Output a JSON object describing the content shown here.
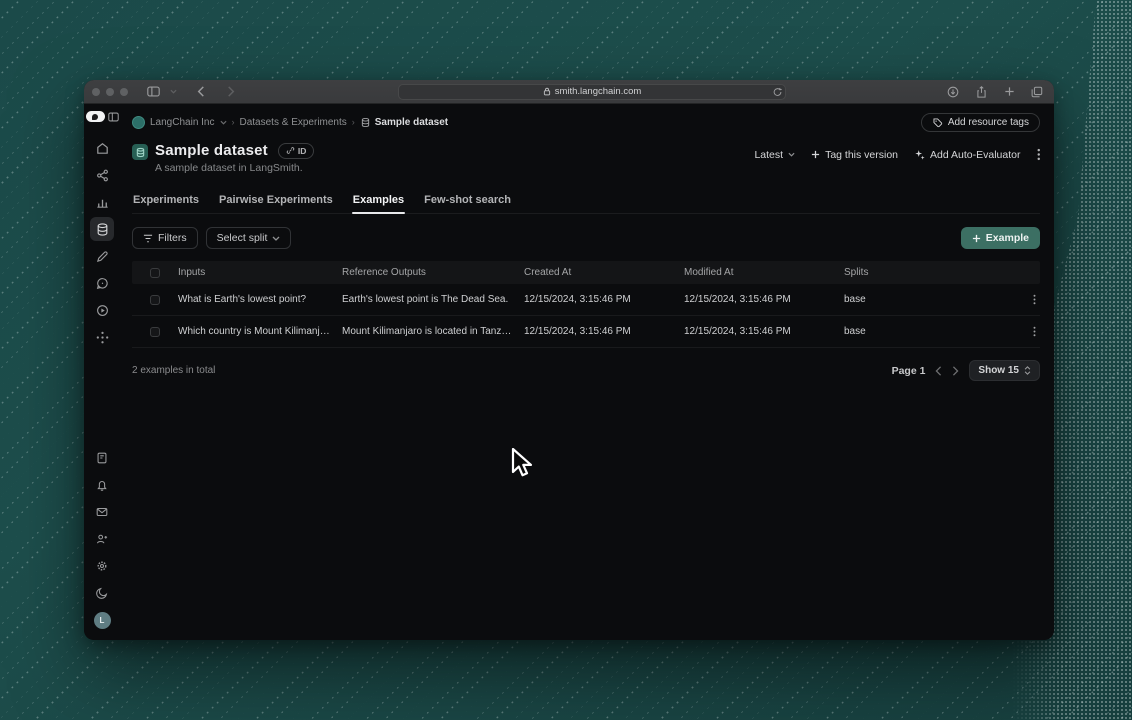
{
  "browser": {
    "url": "smith.langchain.com"
  },
  "breadcrumb": {
    "org": "LangChain Inc",
    "section": "Datasets & Experiments",
    "page": "Sample dataset"
  },
  "topbar": {
    "add_resource_tags": "Add resource tags"
  },
  "dataset": {
    "title": "Sample dataset",
    "subtitle": "A sample dataset in LangSmith.",
    "id_badge": "ID"
  },
  "actions": {
    "version": "Latest",
    "tag_version": "Tag this version",
    "add_auto_evaluator": "Add Auto-Evaluator"
  },
  "tabs": [
    {
      "label": "Experiments",
      "active": false
    },
    {
      "label": "Pairwise Experiments",
      "active": false
    },
    {
      "label": "Examples",
      "active": true
    },
    {
      "label": "Few-shot search",
      "active": false
    }
  ],
  "toolbar": {
    "filters": "Filters",
    "select_split": "Select split",
    "add_example": "Example"
  },
  "table": {
    "columns": [
      "Inputs",
      "Reference Outputs",
      "Created At",
      "Modified At",
      "Splits"
    ],
    "rows": [
      {
        "inputs": "What is Earth's lowest point?",
        "reference_outputs": "Earth's lowest point is The Dead Sea.",
        "created_at": "12/15/2024, 3:15:46 PM",
        "modified_at": "12/15/2024, 3:15:46 PM",
        "splits": "base"
      },
      {
        "inputs": "Which country is Mount Kilimanjaro...",
        "reference_outputs": "Mount Kilimanjaro is located in Tanzania.",
        "created_at": "12/15/2024, 3:15:46 PM",
        "modified_at": "12/15/2024, 3:15:46 PM",
        "splits": "base"
      }
    ]
  },
  "footer": {
    "total": "2 examples in total",
    "page": "Page 1",
    "show": "Show 15"
  },
  "sidebar": {
    "icons": [
      "home",
      "tracing",
      "monitoring",
      "datasets",
      "annotation",
      "chat",
      "playground",
      "prompts",
      "docs",
      "notifications",
      "mail",
      "invite",
      "settings",
      "dark-mode"
    ],
    "avatar_initial": "L"
  },
  "colors": {
    "accent": "#3c6f63",
    "desktop_background": "#1d4a48",
    "app_background": "#0b0c0e",
    "dataset_icon": "#275f54"
  }
}
